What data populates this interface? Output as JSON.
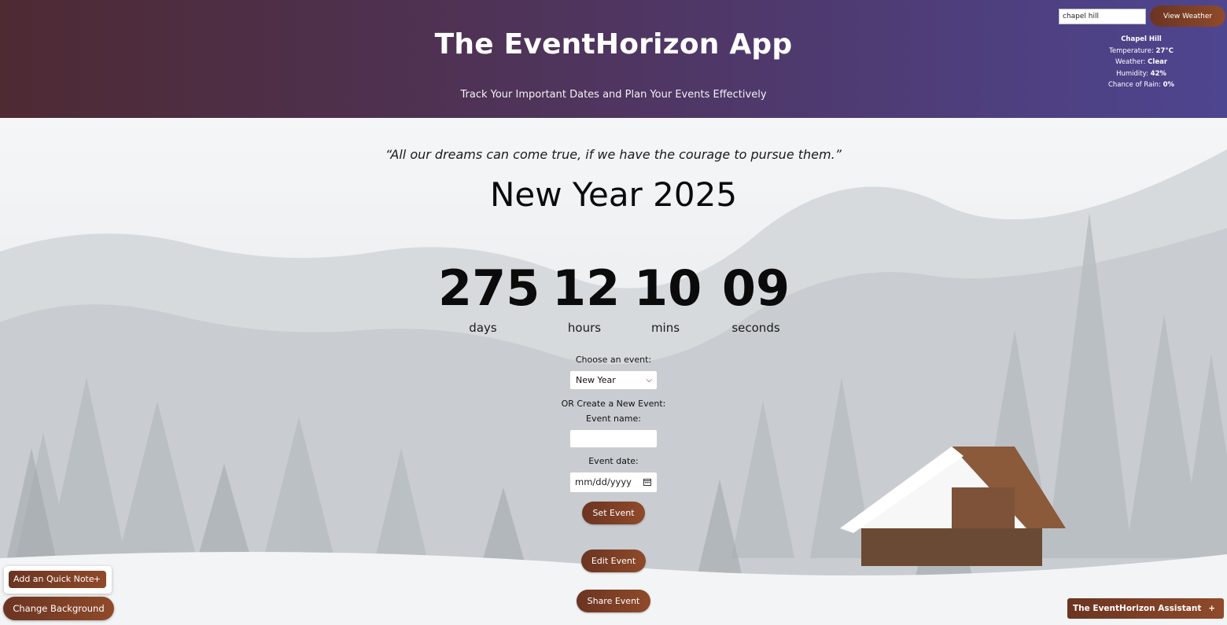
{
  "header": {
    "title": "The EventHorizon App",
    "subtitle": "Track Your Important Dates and Plan Your Events Effectively"
  },
  "weather": {
    "input_value": "chapel hill",
    "button_label": "View Weather",
    "city": "Chapel Hill",
    "temperature_label": "Temperature:",
    "temperature_value": "27°C",
    "weather_label": "Weather:",
    "weather_value": "Clear",
    "humidity_label": "Humidity:",
    "humidity_value": "42%",
    "rain_label": "Chance of Rain:",
    "rain_value": "0%"
  },
  "main": {
    "quote": "“All our dreams can come true, if we have the courage to pursue them.”",
    "event_title": "New Year 2025",
    "countdown": [
      {
        "value": "275",
        "label": "days"
      },
      {
        "value": "12",
        "label": "hours"
      },
      {
        "value": "10",
        "label": "mins"
      },
      {
        "value": "09",
        "label": "seconds"
      }
    ]
  },
  "form": {
    "choose_label": "Choose an event:",
    "selected_event": "New Year",
    "or_create_label": "OR Create a New Event:",
    "event_name_label": "Event name:",
    "event_name_value": "",
    "event_date_label": "Event date:",
    "event_date_placeholder": "mm/dd/yyyy",
    "set_button": "Set Event",
    "edit_button": "Edit Event",
    "share_button": "Share Event"
  },
  "corner": {
    "quick_note_label": "Add an Quick Note",
    "quick_note_plus": "+",
    "change_background_label": "Change Background",
    "assistant_label": "The EventHorizon Assistant",
    "assistant_plus": "+"
  },
  "colors": {
    "header_start": "#4e2a33",
    "header_end": "#4e4590",
    "button_brown": "#7a3d25"
  }
}
